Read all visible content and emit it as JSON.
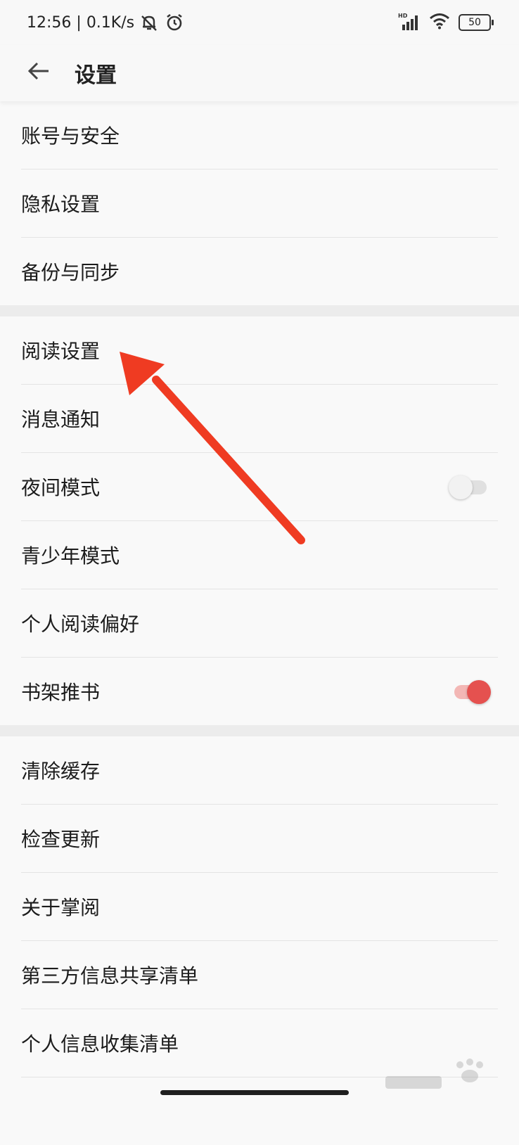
{
  "status_bar": {
    "time": "12:56",
    "network_speed": "0.1K/s",
    "signal_badge": "HD",
    "battery": "50",
    "icons": [
      "dnd-bell-off-icon",
      "alarm-icon",
      "signal-icon",
      "wifi-icon",
      "battery-icon"
    ]
  },
  "header": {
    "back_icon": "arrow-left-icon",
    "title": "设置"
  },
  "groups": [
    {
      "items": [
        {
          "label": "账号与安全"
        },
        {
          "label": "隐私设置"
        },
        {
          "label": "备份与同步"
        }
      ]
    },
    {
      "items": [
        {
          "label": "阅读设置"
        },
        {
          "label": "消息通知"
        },
        {
          "label": "夜间模式",
          "toggle": "off"
        },
        {
          "label": "青少年模式"
        },
        {
          "label": "个人阅读偏好"
        },
        {
          "label": "书架推书",
          "toggle": "on"
        }
      ]
    },
    {
      "items": [
        {
          "label": "清除缓存"
        },
        {
          "label": "检查更新"
        },
        {
          "label": "关于掌阅"
        },
        {
          "label": "第三方信息共享清单"
        },
        {
          "label": "个人信息收集清单"
        }
      ]
    }
  ],
  "colors": {
    "accent": "#e5514f",
    "annotation_arrow": "#ef3b22",
    "divider_band": "#ececec"
  }
}
